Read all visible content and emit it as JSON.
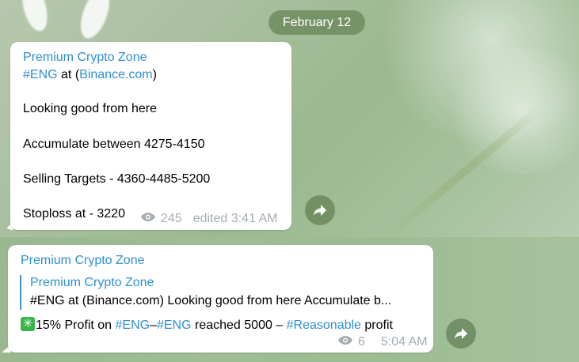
{
  "date_separator": "February 12",
  "message1": {
    "sender": "Premium Crypto Zone",
    "tag": "#ENG",
    "at_text": " at (",
    "link": "Binance.com",
    "close_paren": ")",
    "line2": "Looking good from here",
    "line3": "Accumulate between 4275-4150",
    "line4": "Selling Targets - 4360-4485-5200",
    "line5": "Stoploss at - 3220",
    "views": "245",
    "time": "edited 3:41 AM"
  },
  "message2": {
    "sender": "Premium Crypto Zone",
    "quote_sender": "Premium Crypto Zone",
    "quote_text": "#ENG at (Binance.com)  Looking good from here  Accumulate b...",
    "text_part1": "15% Profit on ",
    "tag1": "#ENG",
    "dash1": "–",
    "tag2": "#ENG",
    "text_part2": " reached 5000 – ",
    "tag3": "#Reasonable",
    "text_part3": " profit",
    "sparkle_glyph": "✳",
    "views": "6",
    "time": "5:04 AM"
  },
  "icons": {
    "eye": "eye-icon",
    "forward": "forward-arrow-icon",
    "sparkle": "eight-spoked-asterisk-icon"
  },
  "colors": {
    "link": "#2f8fd1",
    "meta": "#a6adb4",
    "bubble": "#ffffff",
    "date_pill": "#6e8c5f"
  }
}
